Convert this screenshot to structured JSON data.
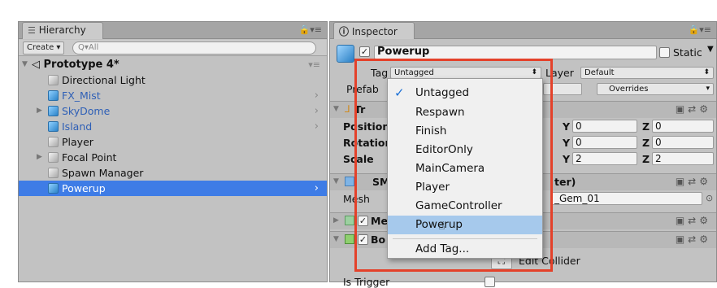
{
  "hierarchy": {
    "tab_label": "Hierarchy",
    "create_label": "Create",
    "search_placeholder": "Q▾All",
    "scene_name": "Prototype 4*",
    "items": [
      {
        "label": "Directional Light",
        "prefab": false,
        "expandable": false,
        "selected": false,
        "has_children_arrow": false
      },
      {
        "label": "FX_Mist",
        "prefab": true,
        "expandable": false,
        "selected": false,
        "has_children_arrow": true
      },
      {
        "label": "SkyDome",
        "prefab": true,
        "expandable": true,
        "selected": false,
        "has_children_arrow": true
      },
      {
        "label": "Island",
        "prefab": true,
        "expandable": false,
        "selected": false,
        "has_children_arrow": true
      },
      {
        "label": "Player",
        "prefab": false,
        "expandable": false,
        "selected": false,
        "has_children_arrow": false
      },
      {
        "label": "Focal Point",
        "prefab": false,
        "expandable": true,
        "selected": false,
        "has_children_arrow": false
      },
      {
        "label": "Spawn Manager",
        "prefab": false,
        "expandable": false,
        "selected": false,
        "has_children_arrow": false
      },
      {
        "label": "Powerup",
        "prefab": true,
        "expandable": false,
        "selected": true,
        "has_children_arrow": true
      }
    ]
  },
  "inspector": {
    "tab_label": "Inspector",
    "object_name": "Powerup",
    "active_checked": true,
    "static_label": "Static",
    "tag_label": "Tag",
    "tag_value": "Untagged",
    "layer_label": "Layer",
    "layer_value": "Default",
    "prefab_label": "Prefab",
    "overrides_label": "Overrides",
    "transform": {
      "title_fragment": "Tr",
      "position_label": "Position",
      "rotation_label": "Rotation",
      "scale_label": "Scale",
      "axis_y": "Y",
      "axis_z": "Z",
      "position_y": "0",
      "position_z": "0",
      "rotation_y": "0",
      "rotation_z": "0",
      "scale_y": "2",
      "scale_z": "2"
    },
    "mesh_filter": {
      "title_fragment": "SM",
      "title_tail": "ter)",
      "mesh_label": "Mesh",
      "mesh_value_fragment": "_Gem_01"
    },
    "mesh_renderer_fragment": "Me",
    "box_collider_fragment": "Bo",
    "edit_collider_label": "Edit Collider",
    "is_trigger_label": "Is Trigger"
  },
  "tag_menu": {
    "items": [
      {
        "label": "Untagged",
        "checked": true,
        "hover": false
      },
      {
        "label": "Respawn",
        "checked": false,
        "hover": false
      },
      {
        "label": "Finish",
        "checked": false,
        "hover": false
      },
      {
        "label": "EditorOnly",
        "checked": false,
        "hover": false
      },
      {
        "label": "MainCamera",
        "checked": false,
        "hover": false
      },
      {
        "label": "Player",
        "checked": false,
        "hover": false
      },
      {
        "label": "GameController",
        "checked": false,
        "hover": false
      },
      {
        "label": "Powerup",
        "checked": false,
        "hover": true
      }
    ],
    "add_tag_label": "Add Tag..."
  },
  "colors": {
    "selection_blue": "#3e7ce6",
    "menu_hover": "#a6c9ec",
    "highlight_red": "#e4412a",
    "prefab_text_blue": "#2e5fb6"
  }
}
